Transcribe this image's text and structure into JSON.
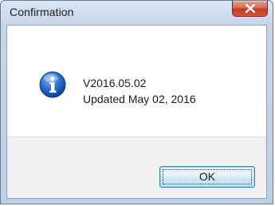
{
  "window": {
    "title": "Confirmation"
  },
  "message": {
    "line1": "V2016.05.02",
    "line2": "Updated May 02, 2016"
  },
  "buttons": {
    "ok_label": "OK"
  },
  "icons": {
    "dialog_icon": "info-icon",
    "close": "close-icon"
  },
  "colors": {
    "close_button": "#c23b22",
    "info_icon": "#1e5fbf",
    "ok_border": "#3c7fb1"
  }
}
